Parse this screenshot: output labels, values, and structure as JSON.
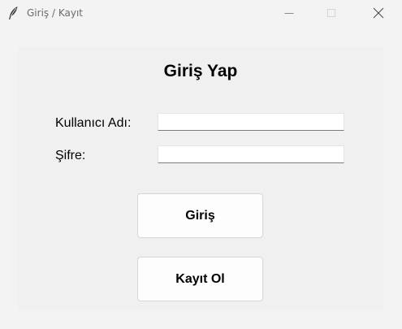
{
  "window": {
    "title": "Giriş / Kayıt",
    "icon": "feather-icon",
    "controls": [
      "minimize-icon",
      "maximize-icon",
      "close-icon"
    ]
  },
  "form": {
    "heading": "Giriş Yap",
    "username_label": "Kullanıcı Adı:",
    "username_value": "",
    "password_label": "Şifre:",
    "password_value": "",
    "login_button": "Giriş",
    "register_button": "Kayıt Ol"
  }
}
